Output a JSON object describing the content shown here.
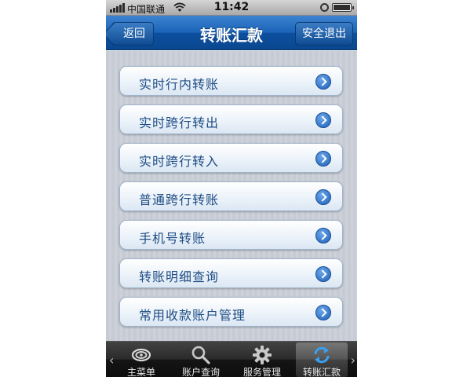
{
  "status": {
    "carrier": "中国联通",
    "time": "11:42"
  },
  "navbar": {
    "title": "转账汇款",
    "back_label": "返回",
    "logout_label": "安全退出"
  },
  "menu": [
    {
      "label": "实时行内转账"
    },
    {
      "label": "实时跨行转出"
    },
    {
      "label": "实时跨行转入"
    },
    {
      "label": "普通跨行转账"
    },
    {
      "label": "手机号转账"
    },
    {
      "label": "转账明细查询"
    },
    {
      "label": "常用收款账户管理"
    }
  ],
  "tabs": [
    {
      "label": "主菜单",
      "icon": "swirl-icon"
    },
    {
      "label": "账户查询",
      "icon": "search-icon"
    },
    {
      "label": "服务管理",
      "icon": "gear-icon"
    },
    {
      "label": "转账汇款",
      "icon": "refresh-icon",
      "active": true
    }
  ],
  "colors": {
    "nav_blue": "#1a63b8",
    "label_blue": "#1e4d85",
    "chevron_blue": "#1b5fb8"
  }
}
